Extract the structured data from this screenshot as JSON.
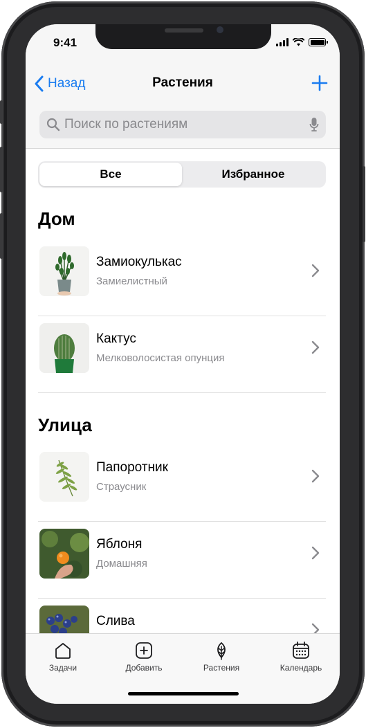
{
  "status": {
    "time": "9:41"
  },
  "nav": {
    "back_label": "Назад",
    "title": "Растения"
  },
  "search": {
    "placeholder": "Поиск по растениям"
  },
  "segments": [
    {
      "label": "Все",
      "selected": true
    },
    {
      "label": "Избранное",
      "selected": false
    }
  ],
  "sections": [
    {
      "title": "Дом",
      "items": [
        {
          "name": "Замиокулькас",
          "subtitle": "Замиелистный",
          "thumb": "zamioculcas"
        },
        {
          "name": "Кактус",
          "subtitle": "Мелковолосистая опунция",
          "thumb": "cactus"
        }
      ]
    },
    {
      "title": "Улица",
      "items": [
        {
          "name": "Папоротник",
          "subtitle": "Страусник",
          "thumb": "fern"
        },
        {
          "name": "Яблоня",
          "subtitle": "Домашняя",
          "thumb": "apple"
        },
        {
          "name": "Слива",
          "subtitle": "",
          "thumb": "plum"
        }
      ]
    }
  ],
  "tabs": [
    {
      "label": "Задачи",
      "icon": "home-icon"
    },
    {
      "label": "Добавить",
      "icon": "plus-square-icon"
    },
    {
      "label": "Растения",
      "icon": "leaf-icon"
    },
    {
      "label": "Календарь",
      "icon": "calendar-icon"
    }
  ],
  "colors": {
    "accent": "#1a7cf0",
    "background": "#f6f6f6",
    "secondary_text": "#8a8a8e"
  }
}
